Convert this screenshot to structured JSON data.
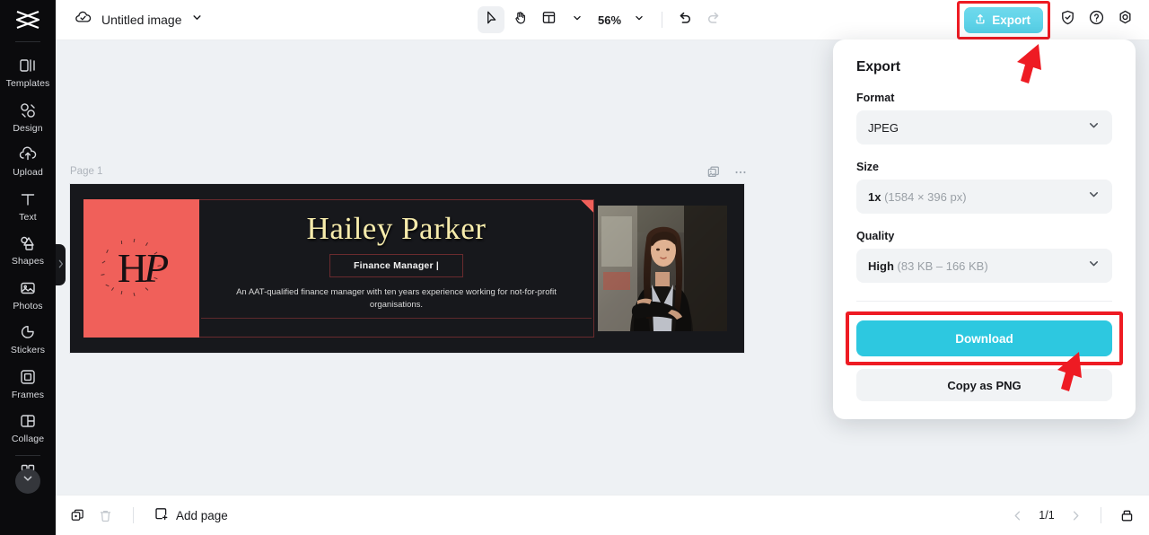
{
  "app": {
    "logo_icon": "capcut-logo-icon"
  },
  "sidebar": {
    "items": [
      {
        "label": "Templates",
        "icon": "templates-icon"
      },
      {
        "label": "Design",
        "icon": "design-icon"
      },
      {
        "label": "Upload",
        "icon": "upload-cloud-icon"
      },
      {
        "label": "Text",
        "icon": "text-icon"
      },
      {
        "label": "Shapes",
        "icon": "shapes-icon"
      },
      {
        "label": "Photos",
        "icon": "photos-icon"
      },
      {
        "label": "Stickers",
        "icon": "stickers-icon"
      },
      {
        "label": "Frames",
        "icon": "frames-icon"
      },
      {
        "label": "Collage",
        "icon": "collage-icon"
      }
    ],
    "more_icon": "grid-apps-icon",
    "expand_icon": "chevron-down-icon",
    "handle_icon": "chevron-right-icon"
  },
  "topbar": {
    "doc_title": "Untitled image",
    "doc_icon": "cloud-check-icon",
    "doc_dropdown_icon": "chevron-down-icon",
    "select_tool_icon": "cursor-select-icon",
    "hand_tool_icon": "hand-pan-icon",
    "layout_tool_icon": "layout-grid-icon",
    "layout_dropdown_icon": "chevron-down-icon",
    "zoom_level": "56%",
    "zoom_dropdown_icon": "chevron-down-icon",
    "undo_icon": "undo-icon",
    "redo_icon": "redo-icon",
    "export_label": "Export",
    "export_icon": "upload-share-icon",
    "shield_icon": "shield-check-icon",
    "help_icon": "question-circle-icon",
    "settings_icon": "gear-icon"
  },
  "canvas": {
    "page_label": "Page 1",
    "duplicate_page_icon": "duplicate-page-icon",
    "more_options_icon": "more-horizontal-icon",
    "design": {
      "name": "Hailey Parker",
      "role": "Finance Manager |",
      "tagline": "An AAT-qualified finance manager with ten years experience working for not-for-profit organisations.",
      "monogram_h": "H",
      "monogram_p": "P",
      "photo_alt": "portrait-photo",
      "accent_color": "#f0605a",
      "name_color": "#f7ecac",
      "background_color": "#17181c",
      "border_color": "#6a2b2e"
    }
  },
  "export_panel": {
    "title": "Export",
    "format_label": "Format",
    "format_value": "JPEG",
    "size_label": "Size",
    "size_value_bold": "1x",
    "size_value_dim": "(1584 × 396 px)",
    "quality_label": "Quality",
    "quality_value_bold": "High",
    "quality_value_dim": "(83 KB – 166 KB)",
    "download_label": "Download",
    "copy_label": "Copy as PNG",
    "dropdown_icon": "chevron-down-icon",
    "download_color": "#2dc8e0"
  },
  "annotations": {
    "highlight_color": "#ee1b23",
    "arrow_export": "cursor-arrow-annotation",
    "arrow_download": "cursor-arrow-annotation"
  },
  "bottombar": {
    "duplicate_icon": "duplicate-icon",
    "delete_icon": "trash-icon",
    "add_page_label": "Add page",
    "add_page_icon": "add-page-icon",
    "prev_icon": "chevron-left-icon",
    "page_indicator": "1/1",
    "next_icon": "chevron-right-icon",
    "grid_view_icon": "pages-panel-icon"
  }
}
